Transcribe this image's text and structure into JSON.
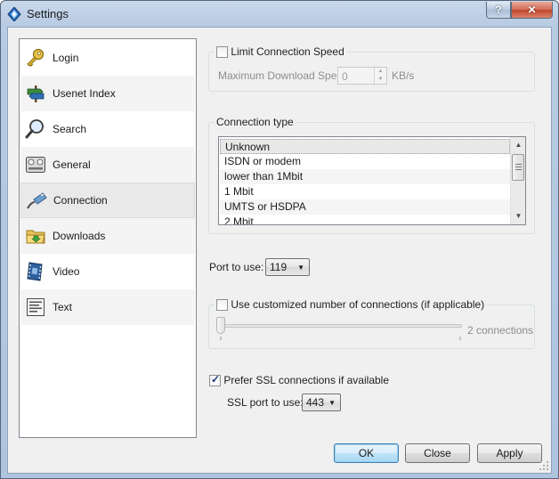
{
  "window": {
    "title": "Settings",
    "help_label": "?",
    "close_label": "✕"
  },
  "sidebar": {
    "items": [
      {
        "label": "Login",
        "icon": "key-icon"
      },
      {
        "label": "Usenet Index",
        "icon": "signpost-icon"
      },
      {
        "label": "Search",
        "icon": "magnifier-icon"
      },
      {
        "label": "General",
        "icon": "control-panel-icon"
      },
      {
        "label": "Connection",
        "icon": "network-cable-icon",
        "selected": true
      },
      {
        "label": "Downloads",
        "icon": "folder-icon"
      },
      {
        "label": "Video",
        "icon": "film-icon"
      },
      {
        "label": "Text",
        "icon": "text-document-icon"
      }
    ]
  },
  "speed": {
    "checkbox_label": "Limit Connection Speed",
    "checked": false,
    "max_label": "Maximum Download Speed",
    "max_value": "0",
    "unit": "KB/s"
  },
  "connection_type": {
    "group_title": "Connection type",
    "options": [
      "Unknown",
      "ISDN or modem",
      "lower than 1Mbit",
      "1 Mbit",
      "UMTS or HSDPA",
      "2 Mbit"
    ],
    "selected": "Unknown"
  },
  "port": {
    "label": "Port to use:",
    "value": "119"
  },
  "connections": {
    "checkbox_label": "Use customized number of connections (if applicable)",
    "checked": false,
    "value_label": "2 connections"
  },
  "ssl": {
    "checkbox_label": "Prefer SSL connections if available",
    "checked": true,
    "port_label": "SSL port to use:",
    "port_value": "443"
  },
  "buttons": {
    "ok": "OK",
    "close": "Close",
    "apply": "Apply"
  },
  "colors": {
    "titlebar": "#b7cbe3",
    "close_button": "#c1452d",
    "default_button": "#3c7fb1"
  }
}
